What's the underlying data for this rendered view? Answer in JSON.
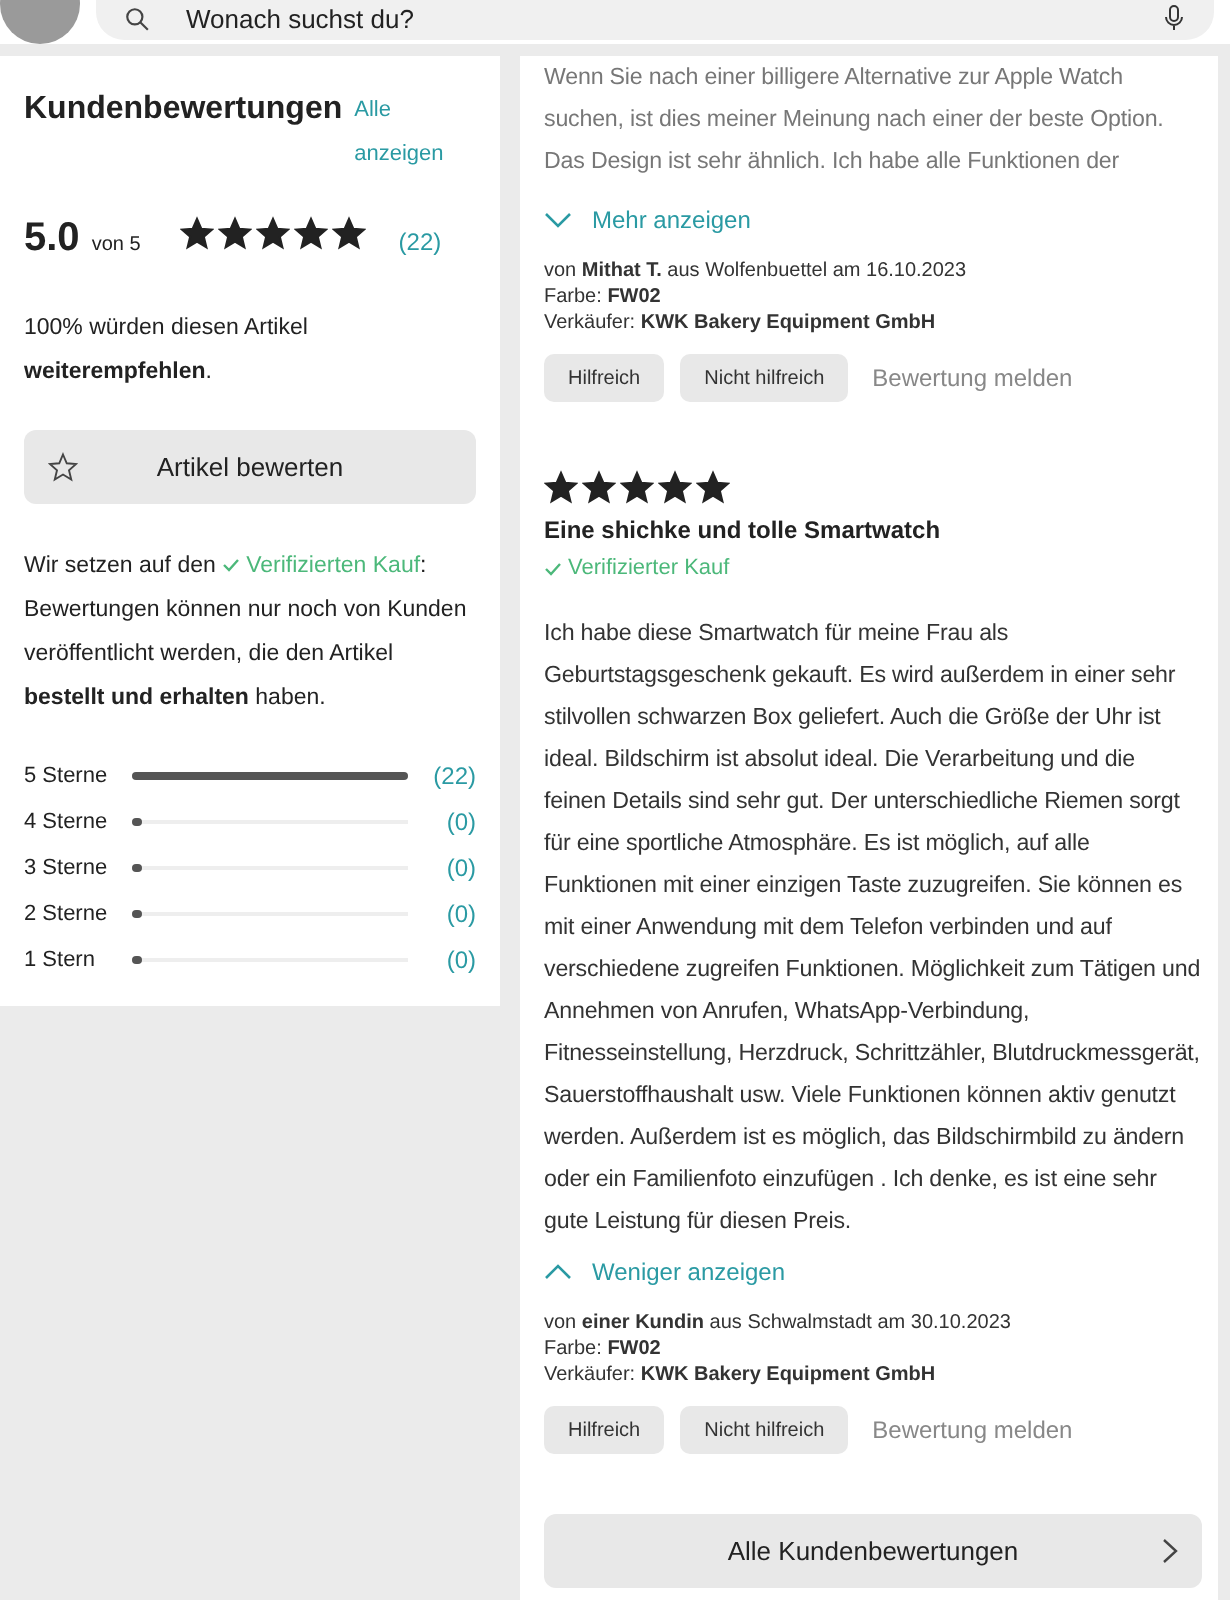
{
  "search": {
    "placeholder": "Wonach suchst du?"
  },
  "summary": {
    "title": "Kundenbewertungen",
    "all_link": "Alle anzeigen",
    "score": "5.0",
    "scale": "von 5",
    "stars": 5,
    "count": "(22)",
    "recommend": "100% würden diesen Artikel **weiterempfehlen**.",
    "rate_button": "Artikel bewerten",
    "notice_before": "Wir setzen auf den",
    "notice_link": "Verifizierten Kauf",
    "notice_after": ": Bewertungen können nur noch von Kunden veröffentlicht werden, die den Artikel **bestellt und erhalten** haben."
  },
  "distribution": [
    {
      "label": "5 Sterne",
      "level": 1,
      "count": "(22)"
    },
    {
      "label": "4 Sterne",
      "level": 0,
      "count": "(0)"
    },
    {
      "label": "3 Sterne",
      "level": 0,
      "count": "(0)"
    },
    {
      "label": "2 Sterne",
      "level": 0,
      "count": "(0)"
    },
    {
      "label": "1 Stern",
      "level": 0,
      "count": "(0)"
    }
  ],
  "reviews": [
    {
      "text": "Wenn Sie nach einer billigere Alternative zur Apple Watch suchen, ist dies meiner Meinung nach einer der beste Option. Das Design ist sehr ähnlich. Ich habe alle Funktionen der",
      "expanded": false,
      "toggle": "Mehr anzeigen",
      "author": "von **Mithat T.** aus Wolfenbuettel am 16.10.2023",
      "variant": "Farbe: **FW02**",
      "seller": "Verkäufer: **KWK Bakery Equipment GmbH**",
      "helpful": "Hilfreich",
      "not_helpful": "Nicht hilfreich",
      "report": "Bewertung melden"
    },
    {
      "stars": 5,
      "title": "Eine shichke und tolle Smartwatch",
      "verified": "Verifizierter Kauf",
      "text": "Ich habe diese Smartwatch für meine Frau als Geburtstagsgeschenk gekauft. Es wird außerdem in einer sehr stilvollen schwarzen Box geliefert. Auch die Größe der Uhr ist ideal. Bildschirm ist absolut ideal. Die Verarbeitung und die feinen Details sind sehr gut. Der unterschiedliche Riemen sorgt für eine sportliche Atmosphäre. Es ist möglich, auf alle Funktionen mit einer einzigen Taste zuzugreifen. Sie können es mit einer Anwendung mit dem Telefon verbinden und auf verschiedene zugreifen Funktionen. Möglichkeit zum Tätigen und Annehmen von Anrufen, WhatsApp-Verbindung, Fitnesseinstellung, Herzdruck, Schrittzähler, Blutdruckmessgerät, Sauerstoffhaushalt usw. Viele Funktionen können aktiv genutzt werden. Außerdem ist es möglich, das Bildschirmbild zu ändern oder ein Familienfoto einzufügen . Ich denke, es ist eine sehr gute Leistung für diesen Preis.",
      "expanded": true,
      "toggle": "Weniger anzeigen",
      "author": "von **einer Kundin** aus Schwalmstadt am 30.10.2023",
      "variant": "Farbe: **FW02**",
      "seller": "Verkäufer: **KWK Bakery Equipment GmbH**",
      "helpful": "Hilfreich",
      "not_helpful": "Nicht hilfreich",
      "report": "Bewertung melden"
    }
  ],
  "all_reviews_button": "Alle Kundenbewertungen"
}
